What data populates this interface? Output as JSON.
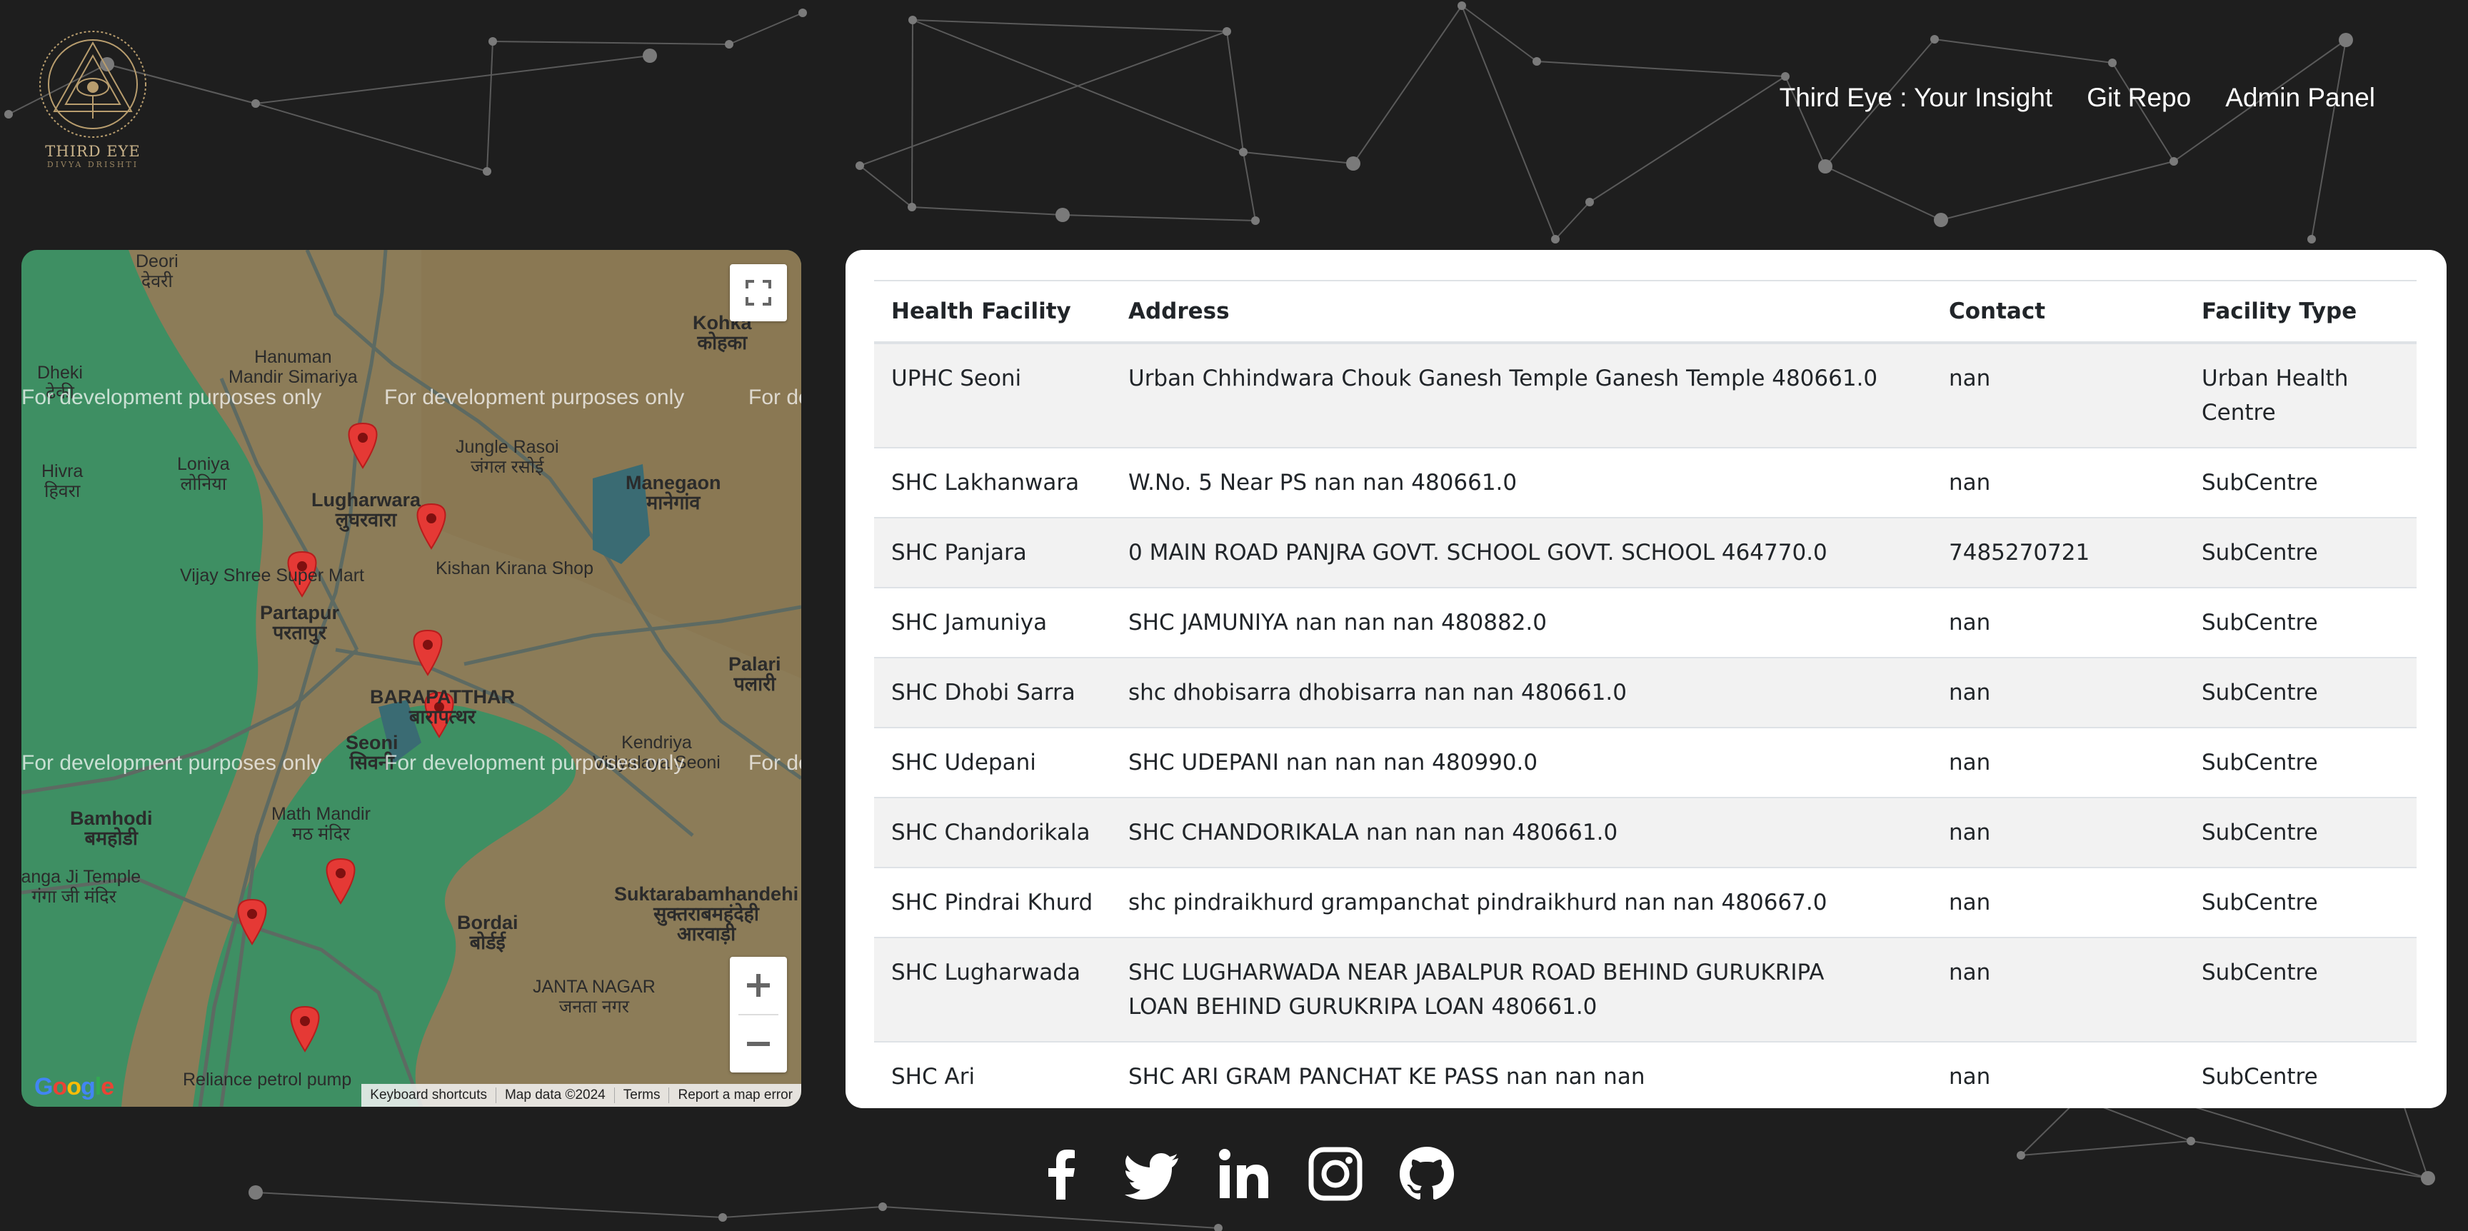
{
  "brand": {
    "name": "THIRD EYE",
    "tagline": "DIVYA DRISHTI"
  },
  "nav": {
    "items": [
      "Third Eye : Your Insight",
      "Git Repo",
      "Admin Panel"
    ]
  },
  "map": {
    "watermark": "For development purposes only",
    "labels": {
      "deori": "Deori\nदेवरी",
      "hanuman": "Hanuman\nMandir Simariya",
      "dheki": "Dheki\nढेकी",
      "hivra": "Hivra\nहिवरा",
      "loniya": "Loniya\nलोनिया",
      "lugharwara": "Lugharwara\nलुघरवारा",
      "jungle": "Jungle Rasoi\nजंगल रसोई",
      "kohka": "Kohka\nकोहका",
      "manegaon": "Manegaon\nमानेगांव",
      "vijay": "Vijay Shree Super Mart",
      "kishan": "Kishan Kirana Shop",
      "partapur": "Partapur\nपरतापुर",
      "barapatthar": "BARAPATTHAR\nबारापत्थर",
      "palari": "Palari\nपलारी",
      "seoni": "Seoni\nसिवनी",
      "kendriya": "Kendriya\nVidyalaya Seoni",
      "bamhodi": "Bamhodi\nबमहोडी",
      "mathmandir": "Math Mandir\nमठ मंदिर",
      "ganga": "Ganga Ji Temple\nगंगा जी मंदिर",
      "suktara": "Suktarabamhandehi\nसुक्तराबमहंदेही\nआरवाड़ी",
      "bordai": "Bordai\nबोर्डई",
      "janta": "JANTA NAGAR\nजनता नगर",
      "reliance": "Reliance petrol pump"
    },
    "footer": [
      "Keyboard shortcuts",
      "Map data ©2024",
      "Terms",
      "Report a map error"
    ],
    "google_logo": "Google"
  },
  "table": {
    "headers": [
      "Health Facility",
      "Address",
      "Contact",
      "Facility Type"
    ],
    "rows": [
      {
        "facility": "UPHC Seoni",
        "address": "Urban Chhindwara Chouk Ganesh Temple Ganesh Temple 480661.0",
        "contact": "nan",
        "type": "Urban Health Centre"
      },
      {
        "facility": "SHC Lakhanwara",
        "address": "W.No. 5 Near PS nan nan 480661.0",
        "contact": "nan",
        "type": "SubCentre"
      },
      {
        "facility": "SHC Panjara",
        "address": "0 MAIN ROAD PANJRA GOVT. SCHOOL GOVT. SCHOOL 464770.0",
        "contact": "7485270721",
        "type": "SubCentre"
      },
      {
        "facility": "SHC Jamuniya",
        "address": "SHC JAMUNIYA nan nan nan 480882.0",
        "contact": "nan",
        "type": "SubCentre"
      },
      {
        "facility": "SHC Dhobi Sarra",
        "address": "shc dhobisarra dhobisarra nan nan 480661.0",
        "contact": "nan",
        "type": "SubCentre"
      },
      {
        "facility": "SHC Udepani",
        "address": "SHC UDEPANI nan nan nan 480990.0",
        "contact": "nan",
        "type": "SubCentre"
      },
      {
        "facility": "SHC Chandorikala",
        "address": "SHC CHANDORIKALA nan nan nan 480661.0",
        "contact": "nan",
        "type": "SubCentre"
      },
      {
        "facility": "SHC Pindrai Khurd",
        "address": "shc pindraikhurd grampanchat pindraikhurd nan nan 480667.0",
        "contact": "nan",
        "type": "SubCentre"
      },
      {
        "facility": "SHC Lugharwada",
        "address": "SHC LUGHARWADA NEAR JABALPUR ROAD BEHIND GURUKRIPA LOAN BEHIND GURUKRIPA LOAN 480661.0",
        "contact": "nan",
        "type": "SubCentre"
      },
      {
        "facility": "SHC Ari",
        "address": "SHC ARI GRAM PANCHAT KE PASS nan nan nan",
        "contact": "nan",
        "type": "SubCentre"
      }
    ]
  },
  "social": [
    "facebook-icon",
    "twitter-icon",
    "linkedin-icon",
    "instagram-icon",
    "github-icon"
  ]
}
